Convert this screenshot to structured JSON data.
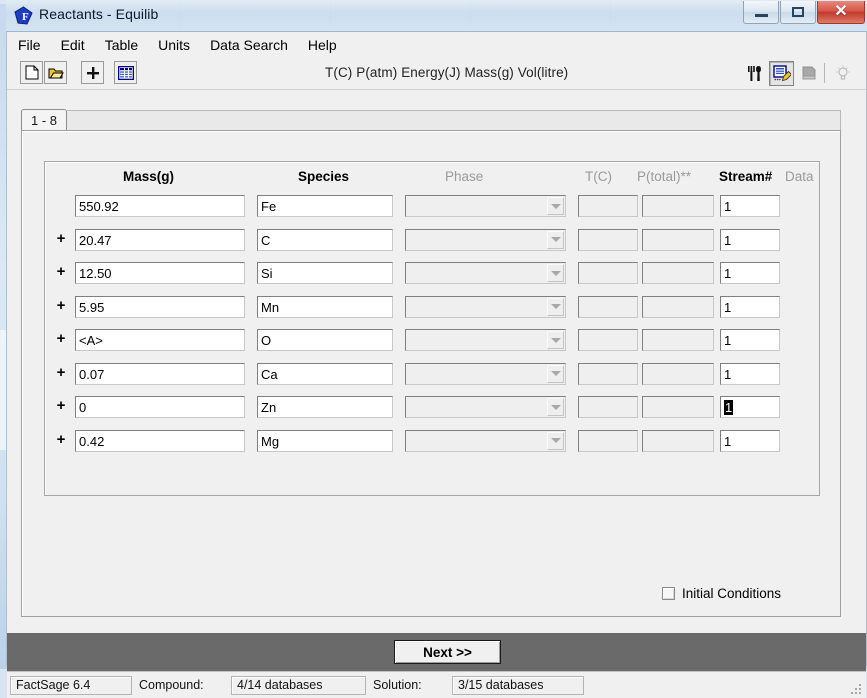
{
  "window": {
    "title": "Reactants - Equilib",
    "icon": "factsage-f-icon",
    "buttons": {
      "minimize": "–",
      "maximize": "□",
      "close": "✕"
    }
  },
  "menu": {
    "items": [
      "File",
      "Edit",
      "Table",
      "Units",
      "Data Search",
      "Help"
    ]
  },
  "toolbar": {
    "left_icons": [
      "new-document-icon",
      "open-folder-icon",
      "plus-icon",
      "table-grid-icon"
    ],
    "units_text": "T(C) P(atm) Energy(J) Mass(g) Vol(litre)",
    "right_icons": [
      "cutlery-icon",
      "note-edit-icon",
      "clipboard-icon",
      "lightbulb-icon"
    ]
  },
  "tabs": {
    "active": "1 - 8"
  },
  "table": {
    "headers": {
      "mass": "Mass(g)",
      "species": "Species",
      "phase": "Phase",
      "tc": "T(C)",
      "ptotal": "P(total)**",
      "stream": "Stream#",
      "data": "Data"
    },
    "plus_label": "+",
    "rows": [
      {
        "plus": "",
        "mass": "550.92",
        "species": "Fe",
        "phase": "",
        "tc": "",
        "ptotal": "",
        "stream": "1",
        "stream_selected": false
      },
      {
        "plus": "+",
        "mass": "20.47",
        "species": "C",
        "phase": "",
        "tc": "",
        "ptotal": "",
        "stream": "1",
        "stream_selected": false
      },
      {
        "plus": "+",
        "mass": "12.50",
        "species": "Si",
        "phase": "",
        "tc": "",
        "ptotal": "",
        "stream": "1",
        "stream_selected": false
      },
      {
        "plus": "+",
        "mass": "5.95",
        "species": "Mn",
        "phase": "",
        "tc": "",
        "ptotal": "",
        "stream": "1",
        "stream_selected": false
      },
      {
        "plus": "+",
        "mass": "<A>",
        "species": "O",
        "phase": "",
        "tc": "",
        "ptotal": "",
        "stream": "1",
        "stream_selected": false
      },
      {
        "plus": "+",
        "mass": "0.07",
        "species": "Ca",
        "phase": "",
        "tc": "",
        "ptotal": "",
        "stream": "1",
        "stream_selected": false
      },
      {
        "plus": "+",
        "mass": "0",
        "species": "Zn",
        "phase": "",
        "tc": "",
        "ptotal": "",
        "stream": "1",
        "stream_selected": true
      },
      {
        "plus": "+",
        "mass": "0.42",
        "species": "Mg",
        "phase": "",
        "tc": "",
        "ptotal": "",
        "stream": "1",
        "stream_selected": false
      }
    ]
  },
  "initial_conditions": {
    "label": "Initial Conditions",
    "checked": false
  },
  "next_button": {
    "label": "Next >>"
  },
  "statusbar": {
    "version": "FactSage 6.4",
    "compound_label": "Compound:",
    "compound_value": "4/14 databases",
    "solution_label": "Solution:",
    "solution_value": "3/15 databases"
  },
  "colors": {
    "window_bg": "#f0f0f0",
    "next_bar": "#6a6a6a",
    "close_red": "#c03a2c",
    "dim_header": "#9a9a9a",
    "accent_icon": "#00008b"
  }
}
